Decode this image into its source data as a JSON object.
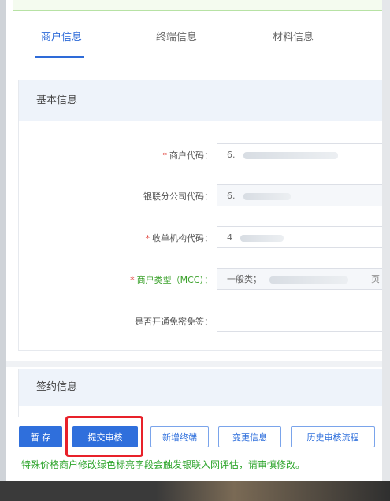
{
  "tabs": [
    {
      "label": "商户信息",
      "active": true
    },
    {
      "label": "终端信息",
      "active": false
    },
    {
      "label": "材料信息",
      "active": false
    }
  ],
  "basic_info": {
    "title": "基本信息",
    "fields": [
      {
        "label": "商户代码：",
        "required": true,
        "value": "6.",
        "readonly": false
      },
      {
        "label": "银联分公司代码：",
        "required": false,
        "value": "6.",
        "readonly": true
      },
      {
        "label": "收单机构代码：",
        "required": true,
        "value": "4",
        "readonly": false
      },
      {
        "label": "商户类型（MCC）：",
        "required": true,
        "highlight": true,
        "value": "一般类；",
        "suffix": "页",
        "readonly": true
      },
      {
        "label": "是否开通免密免签：",
        "required": false,
        "value": "",
        "readonly": false
      }
    ]
  },
  "sign_info": {
    "title": "签约信息"
  },
  "buttons": {
    "save": "暂 存",
    "submit": "提交审核",
    "add_terminal": "新增终端",
    "change_info": "变更信息",
    "history": "历史审核流程"
  },
  "warning": "特殊价格商户修改绿色标亮字段会触发银联入网评估，请审慎修改。",
  "colors": {
    "primary": "#2f6fdc",
    "required": "#e0413a",
    "green": "#3aa12a",
    "highlight_border": "#e8212a"
  }
}
